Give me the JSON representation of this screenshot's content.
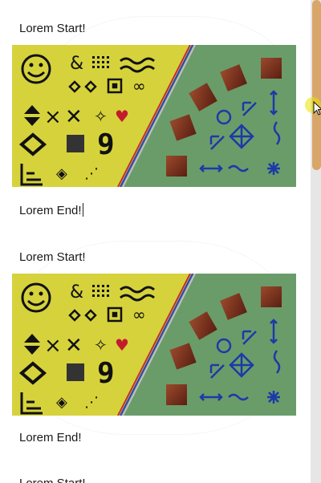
{
  "blocks": [
    {
      "start_label": "Lorem Start!",
      "end_label": "Lorem End!",
      "image": "pattern-panel"
    },
    {
      "start_label": "Lorem Start!",
      "end_label": "Lorem End!",
      "image": "pattern-panel"
    }
  ],
  "trailing_label": "Lorem Start!",
  "colors": {
    "panel_left": "#d6d23c",
    "panel_right": "#6a9c6a",
    "glyph_dark": "#111111",
    "glyph_blue": "#1c3aa8",
    "tile_brown": "#7a2e1c",
    "scroll_thumb": "#d9a66a",
    "scroll_track": "#e6e6e6"
  },
  "icons": [
    "smiley-icon",
    "ampersand-icon",
    "waves-icon",
    "diamond-icon",
    "heart-icon",
    "nine-icon",
    "arrow-icon",
    "circle-icon",
    "compass-icon",
    "squiggle-icon",
    "asterisk-icon"
  ]
}
